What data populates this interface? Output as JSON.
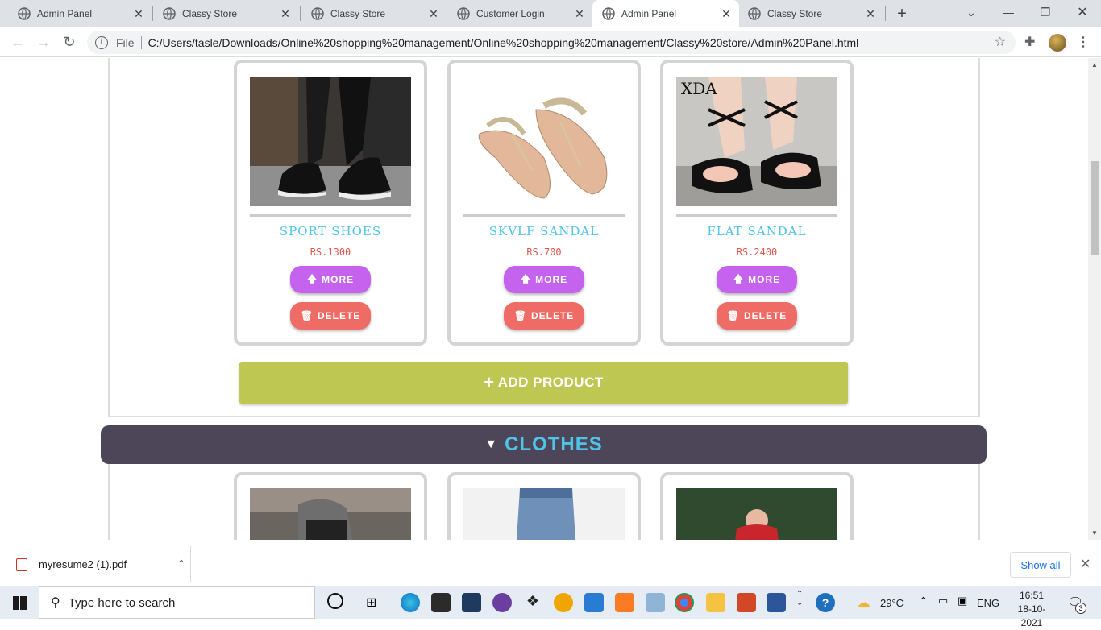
{
  "browser": {
    "tabs": [
      {
        "title": "Admin Panel",
        "active": false
      },
      {
        "title": "Classy Store",
        "active": false
      },
      {
        "title": "Classy Store",
        "active": false
      },
      {
        "title": "Customer Login",
        "active": false
      },
      {
        "title": "Admin Panel",
        "active": true
      },
      {
        "title": "Classy Store",
        "active": false
      }
    ],
    "file_label": "File",
    "url": "C:/Users/tasle/Downloads/Online%20shopping%20management/Online%20shopping%20management/Classy%20store/Admin%20Panel.html"
  },
  "products": [
    {
      "name": "SPORT SHOES",
      "price": "RS.1300"
    },
    {
      "name": "SKVLF SANDAL",
      "price": "RS.700"
    },
    {
      "name": "FLAT SANDAL",
      "price": "RS.2400",
      "image_caption": "XDA"
    }
  ],
  "buttons": {
    "more": "MORE",
    "delete": "DELETE",
    "add_product": "ADD PRODUCT"
  },
  "category": {
    "title": "CLOTHES"
  },
  "downloads": {
    "file": "myresume2 (1).pdf",
    "show_all": "Show all"
  },
  "taskbar": {
    "search_placeholder": "Type here to search",
    "weather": "29°C",
    "language": "ENG",
    "time": "16:51",
    "date": "18-10-2021",
    "notifications": "3"
  },
  "colors": {
    "accent_name": "#4fc3e8",
    "price": "#e0564f",
    "more": "#c562ee",
    "delete": "#ee6b66",
    "add": "#bec752",
    "category_bar": "#4d4558"
  }
}
